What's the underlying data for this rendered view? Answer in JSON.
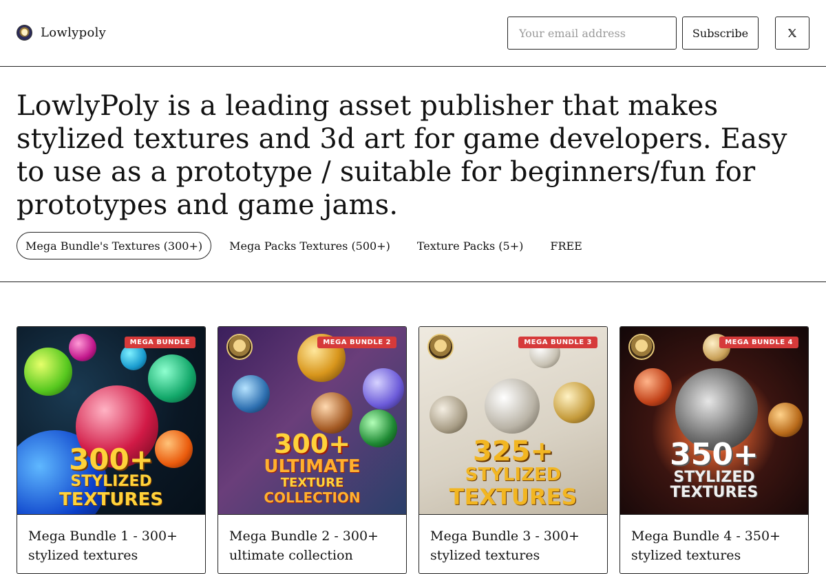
{
  "header": {
    "brand_name": "Lowlypoly",
    "email_placeholder": "Your email address",
    "subscribe_label": "Subscribe",
    "x_icon": "x-logo-icon"
  },
  "hero": {
    "text": "LowlyPoly is a leading asset publisher that makes stylized textures and 3d art for game developers. Easy to use as a prototype / suitable for beginners/fun for prototypes and game jams."
  },
  "tabs": [
    {
      "label": "Mega Bundle's Textures (300+)",
      "active": true
    },
    {
      "label": "Mega Packs Textures (500+)",
      "active": false
    },
    {
      "label": "Texture Packs (5+)",
      "active": false
    },
    {
      "label": "FREE",
      "active": false
    }
  ],
  "cards": [
    {
      "title": "Mega Bundle 1 - 300+ stylized textures",
      "badge": "MEGA BUNDLE",
      "big": "300+",
      "line1": "STYLIZED",
      "line2": "TEXTURES"
    },
    {
      "title": "Mega Bundle 2 - 300+ ultimate collection",
      "badge": "MEGA BUNDLE 2",
      "big": "300+",
      "line1": "ULTIMATE",
      "line2": "TEXTURE",
      "line3": "COLLECTION"
    },
    {
      "title": "Mega Bundle 3 - 300+ stylized textures",
      "badge": "MEGA BUNDLE 3",
      "big": "325+",
      "line1": "STYLIZED",
      "line2": "TEXTURES"
    },
    {
      "title": "Mega Bundle 4 - 350+ stylized textures",
      "badge": "MEGA BUNDLE 4",
      "big": "350+",
      "line1": "STYLIZED",
      "line2": "TEXTURES"
    }
  ],
  "colors": {
    "accent_badge": "#d63a3a",
    "border": "#222222",
    "text": "#111111"
  }
}
